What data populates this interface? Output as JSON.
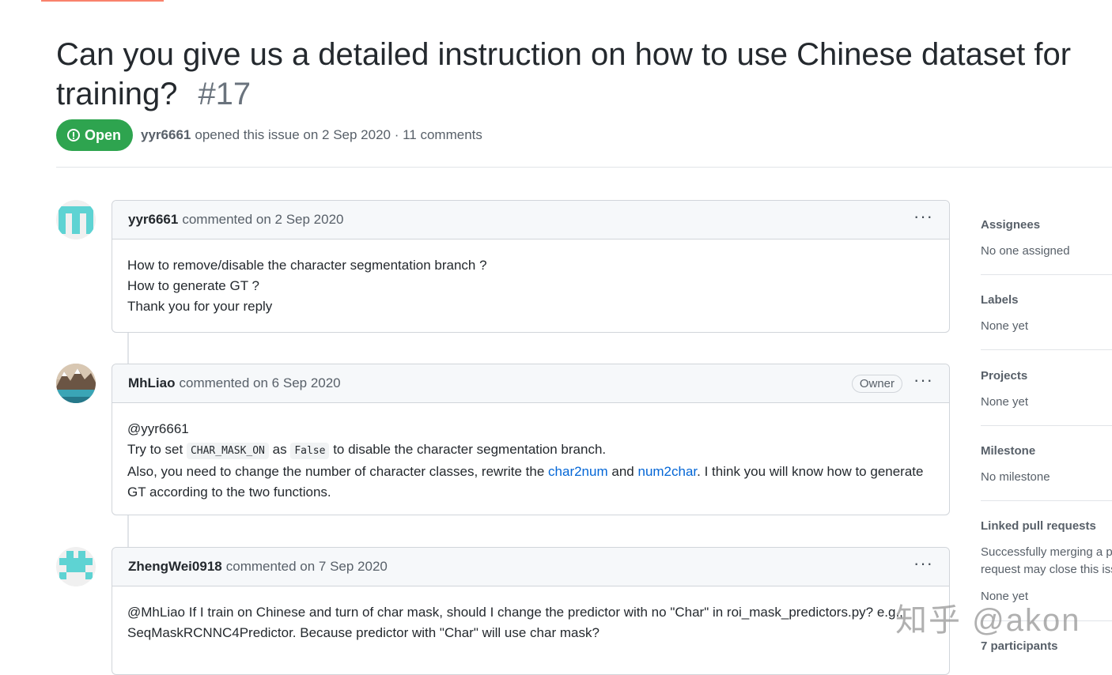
{
  "issue": {
    "title": "Can you give us a detailed instruction on how to use Chinese dataset for training?",
    "number": "#17",
    "state": "Open",
    "author": "yyr6661",
    "opened_text": "opened this issue on 2 Sep 2020 · 11 comments"
  },
  "comments": [
    {
      "author": "yyr6661",
      "meta": "commented on 2 Sep 2020",
      "lines": [
        "How to remove/disable the character segmentation branch ?",
        "How to generate GT ?",
        "Thank you for your reply"
      ]
    },
    {
      "author": "MhLiao",
      "meta": "commented on 6 Sep 2020",
      "badge": "Owner",
      "mention": "@yyr6661",
      "line2_pre": "Try to set",
      "code1": "CHAR_MASK_ON",
      "line2_mid": "as",
      "code2": "False",
      "line2_post": "to disable the character segmentation branch.",
      "line3_pre": "Also, you need to change the number of character classes, rewrite the",
      "link1": "char2num",
      "line3_and": "and",
      "link2": "num2char",
      "line3_post": ". I think you will know how to generate GT according to the two functions."
    },
    {
      "author": "ZhengWei0918",
      "meta": "commented on 7 Sep 2020",
      "mention": "@MhLiao",
      "text": "If I train on Chinese and turn of char mask, should I change the predictor with no \"Char\" in roi_mask_predictors.py? e.g., SeqMaskRCNNC4Predictor. Because predictor with \"Char\" will use char mask?"
    }
  ],
  "sidebar": {
    "assignees": {
      "heading": "Assignees",
      "value": "No one assigned"
    },
    "labels": {
      "heading": "Labels",
      "value": "None yet"
    },
    "projects": {
      "heading": "Projects",
      "value": "None yet"
    },
    "milestone": {
      "heading": "Milestone",
      "value": "No milestone"
    },
    "linked": {
      "heading": "Linked pull requests",
      "value": "Successfully merging a pull request may close this issue.",
      "value2": "None yet"
    },
    "participants": {
      "heading": "7 participants"
    }
  },
  "watermark": "知乎 @akon"
}
